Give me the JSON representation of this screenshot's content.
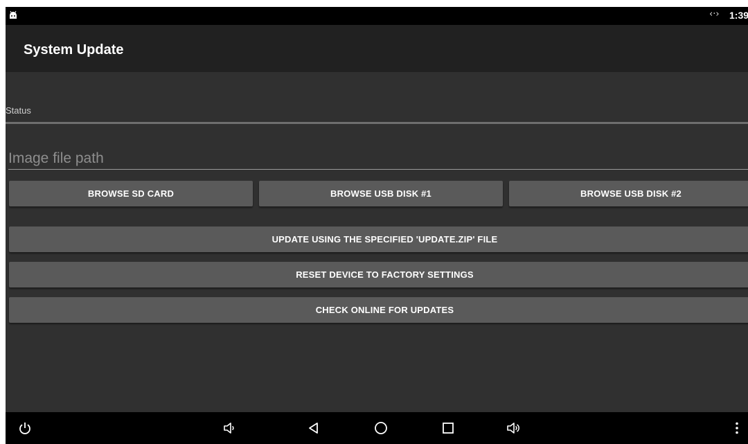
{
  "status_bar": {
    "time": "1:39",
    "icons": [
      "android-icon",
      "sync-icon"
    ]
  },
  "app_bar": {
    "title": "System Update"
  },
  "status": {
    "label": "Status"
  },
  "image_path": {
    "placeholder": "Image file path",
    "value": ""
  },
  "browse_buttons": {
    "sd_card": "BROWSE SD CARD",
    "usb_disk_1": "BROWSE USB DISK #1",
    "usb_disk_2": "BROWSE USB DISK #2"
  },
  "actions": {
    "update_zip": "UPDATE USING THE SPECIFIED 'UPDATE.ZIP' FILE",
    "factory_reset": "RESET DEVICE TO FACTORY SETTINGS",
    "check_online": "CHECK ONLINE FOR UPDATES"
  },
  "nav_bar": {
    "icons": [
      "power-icon",
      "volume-down-icon",
      "back-icon",
      "home-icon",
      "recents-icon",
      "volume-up-icon",
      "more-vert-icon"
    ]
  },
  "colors": {
    "background": "#303030",
    "app_bar": "#212121",
    "button": "#5a5a5a",
    "text": "#ffffff"
  }
}
